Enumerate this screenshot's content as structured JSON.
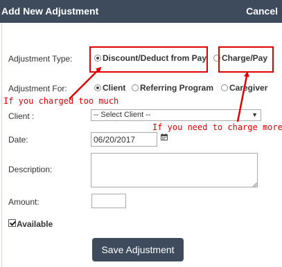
{
  "header": {
    "title": "Add New Adjustment",
    "cancel_label": "Cancel"
  },
  "form": {
    "adjustment_type": {
      "label": "Adjustment Type:",
      "options": [
        {
          "label": "Discount/Deduct from Pay",
          "checked": true
        },
        {
          "label": "Charge/Pay",
          "checked": false
        }
      ]
    },
    "adjustment_for": {
      "label": "Adjustment For:",
      "options": [
        {
          "label": "Client",
          "checked": true
        },
        {
          "label": "Referring Program",
          "checked": false
        },
        {
          "label": "Caregiver",
          "checked": false
        }
      ]
    },
    "client": {
      "label": "Client :",
      "selected": "-- Select Client --"
    },
    "date": {
      "label": "Date:",
      "value": "06/20/2017"
    },
    "description": {
      "label": "Description:",
      "value": ""
    },
    "amount": {
      "label": "Amount:",
      "value": ""
    },
    "available": {
      "label": "Available",
      "checked": true
    },
    "submit_label": "Save Adjustment"
  },
  "annotations": {
    "overcharged": "If you charged too much",
    "charge_more": "If you need to charge more"
  },
  "colors": {
    "header_bg": "#3d4b5c",
    "annotation": "#e00000",
    "button_bg": "#3d4b5c"
  }
}
